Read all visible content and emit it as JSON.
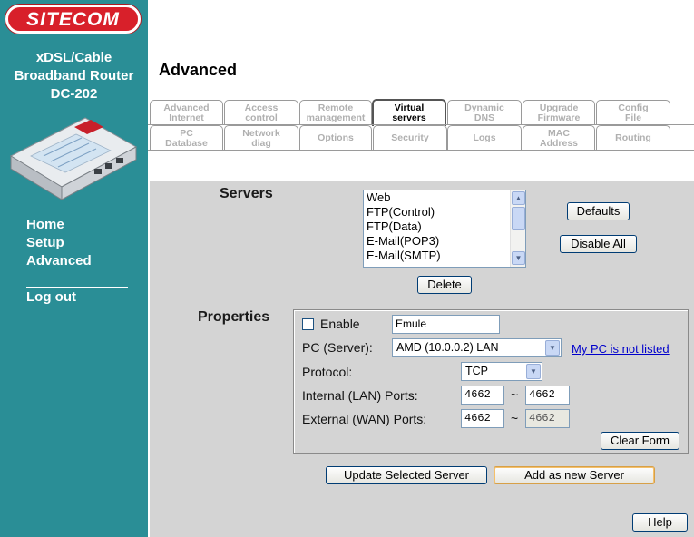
{
  "brand": {
    "logo": "SITECOM",
    "product_lines": [
      "xDSL/Cable",
      "Broadband Router",
      "DC-202"
    ]
  },
  "nav": {
    "home": "Home",
    "setup": "Setup",
    "advanced": "Advanced",
    "logout": "Log out"
  },
  "page_title": "Advanced",
  "tabs_row1": [
    {
      "label": "Advanced Internet",
      "active": false
    },
    {
      "label": "Access control",
      "active": false
    },
    {
      "label": "Remote management",
      "active": false
    },
    {
      "label": "Virtual servers",
      "active": true
    },
    {
      "label": "Dynamic DNS",
      "active": false
    },
    {
      "label": "Upgrade Firmware",
      "active": false
    },
    {
      "label": "Config File",
      "active": false
    }
  ],
  "tabs_row2": [
    {
      "label": "PC Database"
    },
    {
      "label": "Network diag"
    },
    {
      "label": "Options"
    },
    {
      "label": "Security"
    },
    {
      "label": "Logs"
    },
    {
      "label": "MAC Address"
    },
    {
      "label": "Routing"
    }
  ],
  "servers": {
    "label": "Servers",
    "list": [
      "Web",
      "FTP(Control)",
      "FTP(Data)",
      "E-Mail(POP3)",
      "E-Mail(SMTP)"
    ],
    "defaults_button": "Defaults",
    "disable_all_button": "Disable All",
    "delete_button": "Delete"
  },
  "properties": {
    "label": "Properties",
    "enable_label": "Enable",
    "enabled": false,
    "name_value": "Emule",
    "pc_label": "PC (Server):",
    "pc_value": "AMD (10.0.0.2) LAN",
    "not_listed_link": "My PC is not listed",
    "protocol_label": "Protocol:",
    "protocol_value": "TCP",
    "internal_label": "Internal (LAN) Ports:",
    "internal_from": "4662",
    "internal_to": "4662",
    "external_label": "External (WAN) Ports:",
    "external_from": "4662",
    "external_to": "4662",
    "range_sep": "~",
    "clear_button": "Clear Form"
  },
  "actions": {
    "update": "Update Selected Server",
    "add": "Add as new Server",
    "help": "Help"
  },
  "colors": {
    "sidebar": "#2a8e96",
    "content_bg": "#d4d4d4",
    "logo_red": "#d8202a"
  }
}
